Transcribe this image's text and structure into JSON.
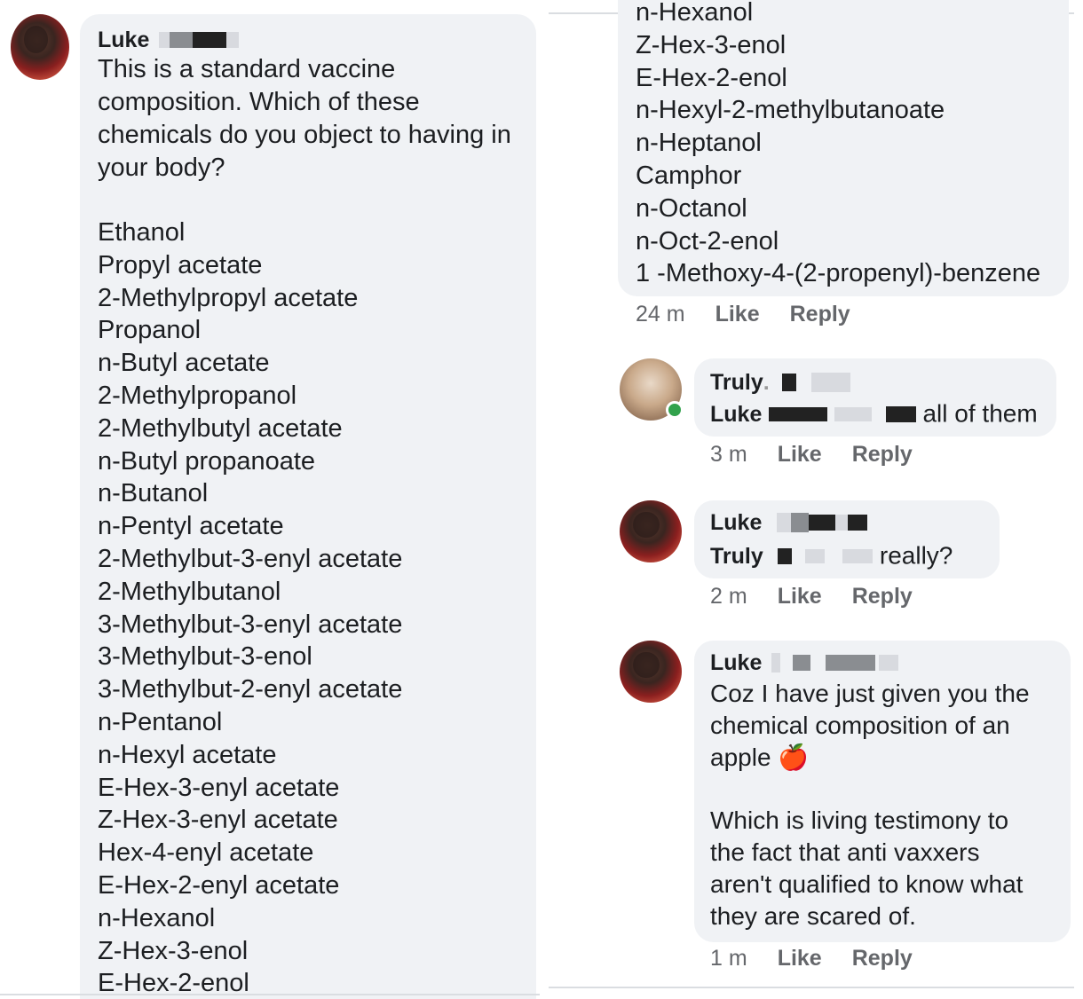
{
  "post": {
    "author": "Luke",
    "text_lines": [
      "This is a standard vaccine",
      "composition. Which of these",
      "chemicals do you object to having in",
      "your body?"
    ],
    "chemicals": [
      "Ethanol",
      "Propyl acetate",
      "2-Methylpropyl acetate",
      "Propanol",
      "n-Butyl acetate",
      "2-Methylpropanol",
      "2-Methylbutyl acetate",
      "n-Butyl propanoate",
      "n-Butanol",
      "n-Pentyl acetate",
      "2-Methylbut-3-enyl acetate",
      "2-Methylbutanol",
      "3-Methylbut-3-enyl acetate",
      "3-Methylbut-3-enol",
      "3-Methylbut-2-enyl acetate",
      "n-Pentanol",
      "n-Hexyl acetate",
      "E-Hex-3-enyl acetate",
      "Z-Hex-3-enyl acetate",
      "Hex-4-enyl acetate",
      "E-Hex-2-enyl acetate",
      "n-Hexanol",
      "Z-Hex-3-enol",
      "E-Hex-2-enol"
    ],
    "chemicals_continued": [
      "n-Hexanol",
      "Z-Hex-3-enol",
      "E-Hex-2-enol",
      "n-Hexyl-2-methylbutanoate",
      "n-Heptanol",
      "Camphor",
      "n-Octanol",
      "n-Oct-2-enol",
      "1 -Methoxy-4-(2-propenyl)-benzene"
    ],
    "time": "24 m",
    "like": "Like",
    "reply": "Reply"
  },
  "comments": [
    {
      "author": "Truly",
      "author_suffix": ".",
      "mention": "Luke",
      "text": "all of them",
      "time": "3 m",
      "like": "Like",
      "reply": "Reply",
      "online": true
    },
    {
      "author": "Luke",
      "mention": "Truly",
      "text": "really?",
      "time": "2 m",
      "like": "Like",
      "reply": "Reply"
    },
    {
      "author": "Luke",
      "text_lines": [
        "Coz I have just given you the",
        "chemical composition of an",
        "apple"
      ],
      "emoji": "🍎",
      "text2_lines": [
        "Which is living testimony to",
        "the fact that anti vaxxers",
        "aren't qualified to know what",
        "they are scared of."
      ],
      "time": "1 m",
      "like": "Like",
      "reply": "Reply"
    }
  ],
  "colors": {
    "bubble": "#f0f2f5",
    "meta": "#65676b",
    "text": "#1c1e21",
    "online": "#31a24c"
  }
}
